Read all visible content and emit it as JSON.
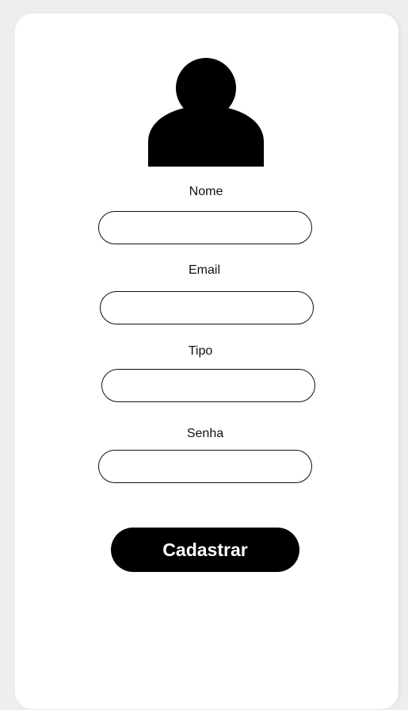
{
  "form": {
    "avatar_icon": "user-icon",
    "fields": {
      "nome": {
        "label": "Nome",
        "value": ""
      },
      "email": {
        "label": "Email",
        "value": ""
      },
      "tipo": {
        "label": "Tipo",
        "value": ""
      },
      "senha": {
        "label": "Senha",
        "value": ""
      }
    },
    "submit_label": "Cadastrar"
  },
  "colors": {
    "page_bg": "#eeeeee",
    "card_bg": "#ffffff",
    "primary": "#000000",
    "button_text": "#ffffff"
  }
}
